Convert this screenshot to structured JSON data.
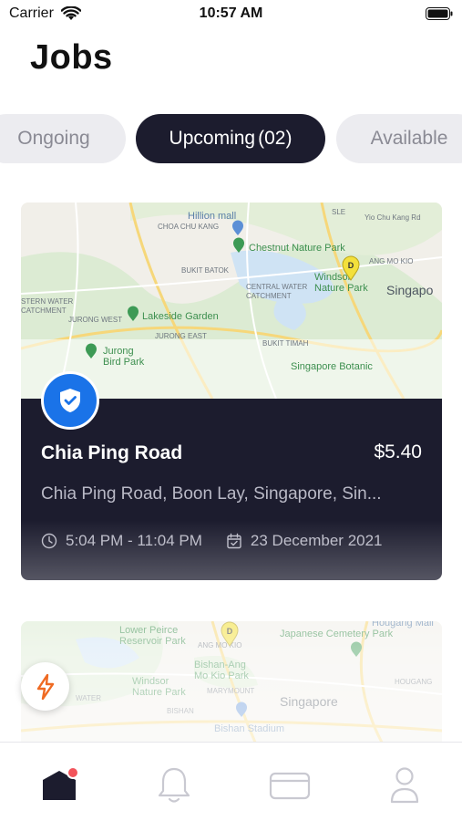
{
  "status_bar": {
    "carrier": "Carrier",
    "time": "10:57 AM",
    "icons": [
      "wifi-icon",
      "battery-icon"
    ]
  },
  "page": {
    "title": "Jobs"
  },
  "tabs": [
    {
      "label": "Ongoing",
      "count": "",
      "active": false
    },
    {
      "label": "Upcoming",
      "count": "(02)",
      "active": true
    },
    {
      "label": "Available",
      "count": "",
      "active": false
    }
  ],
  "jobs": [
    {
      "name": "Chia Ping Road",
      "price": "$5.40",
      "address": "Chia Ping Road, Boon Lay, Singapore, Sin...",
      "time_range": "5:04 PM - 11:04 PM",
      "date": "23 December 2021",
      "badge_icon": "shield-check-icon",
      "map_labels": {
        "hillion": "Hillion mall",
        "chestnut": "Chestnut Nature Park",
        "windsor": "Windsor Nature Park",
        "singapore": "Singapo",
        "lakeside": "Lakeside Garden",
        "jurong": "Jurong Bird Park",
        "choa_chu_kang": "CHOA CHU KANG",
        "bukit_batok": "BUKIT BATOK",
        "central_water": "CENTRAL WATER CATCHMENT",
        "western_water": "STERN WATER CATCHMENT",
        "jurong_west": "JURONG WEST",
        "jurong_east": "JURONG EAST",
        "bukit_timah": "BUKIT TIMAH",
        "singapore_botanic": "Singapore Botanic",
        "ang_mo_kio": "ANG MO KIO",
        "sle": "SLE",
        "yio_chu_kang": "Yio Chu Kang Rd"
      },
      "pin_label": "D"
    },
    {
      "map_labels": {
        "lower_peirce": "Lower Peirce Reservoir Park",
        "ang_mo_kio": "ANG MO KIO",
        "japanese": "Japanese Cemetery Park",
        "hougang_mall": "Hougang Mall",
        "bishan_park": "Bishan-Ang Mo Kio Park",
        "windsor": "Windsor Nature Park",
        "marymount": "MARYMOUNT",
        "singapore": "Singapore",
        "hougang": "HOUGANG",
        "water": "WATER",
        "bishan": "BISHAN",
        "bishan_stadium": "Bishan Stadium"
      },
      "pin_label": "D"
    }
  ],
  "fab": {
    "icon": "lightning-icon"
  },
  "bottom_nav": [
    {
      "icon": "home-icon",
      "active": true,
      "has_notification": true
    },
    {
      "icon": "bell-icon",
      "active": false
    },
    {
      "icon": "card-icon",
      "active": false
    },
    {
      "icon": "profile-icon",
      "active": false
    }
  ],
  "colors": {
    "dark": "#1c1c2e",
    "accent_blue": "#1a73e8",
    "notification": "#f2545b",
    "lightning": "#ef6a22",
    "tab_inactive_bg": "#ececf0"
  }
}
